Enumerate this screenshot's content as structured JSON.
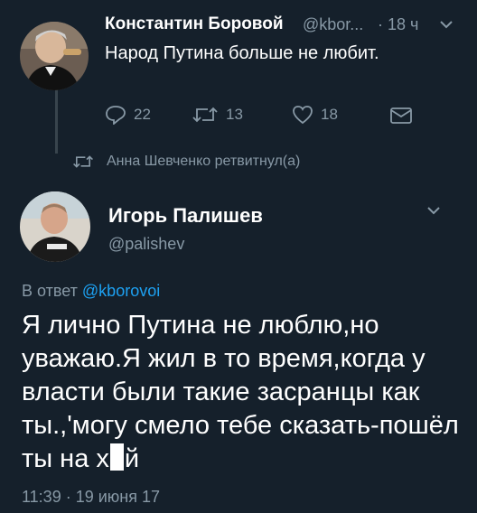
{
  "tweet1": {
    "author_name": "Константин Боровой",
    "author_handle": "@kbor...",
    "time": "· 18 ч",
    "text": "Народ Путина больше не любит.",
    "replies": "22",
    "retweets": "13",
    "likes": "18"
  },
  "retweet_notice": "Анна Шевченко ретвитнул(а)",
  "tweet2": {
    "author_name": "Игорь Палишев",
    "author_handle": "@palishev",
    "reply_prefix": "В ответ",
    "reply_handle": "@kborovoi",
    "text_before": "Я лично Путина не люблю,но уважаю.Я  жил в то время,когда у власти были такие засранцы как ты.,'могу смело тебе сказать-пошёл ты на х",
    "text_after": "й",
    "timestamp": "11:39 · 19 июня 17"
  },
  "colors": {
    "background": "#15202b",
    "muted": "#8899a6",
    "accent": "#1da1f2",
    "thread_line": "#38444d"
  },
  "icons": [
    "reply-icon",
    "retweet-icon",
    "like-icon",
    "direct-message-icon",
    "chevron-down-icon"
  ]
}
